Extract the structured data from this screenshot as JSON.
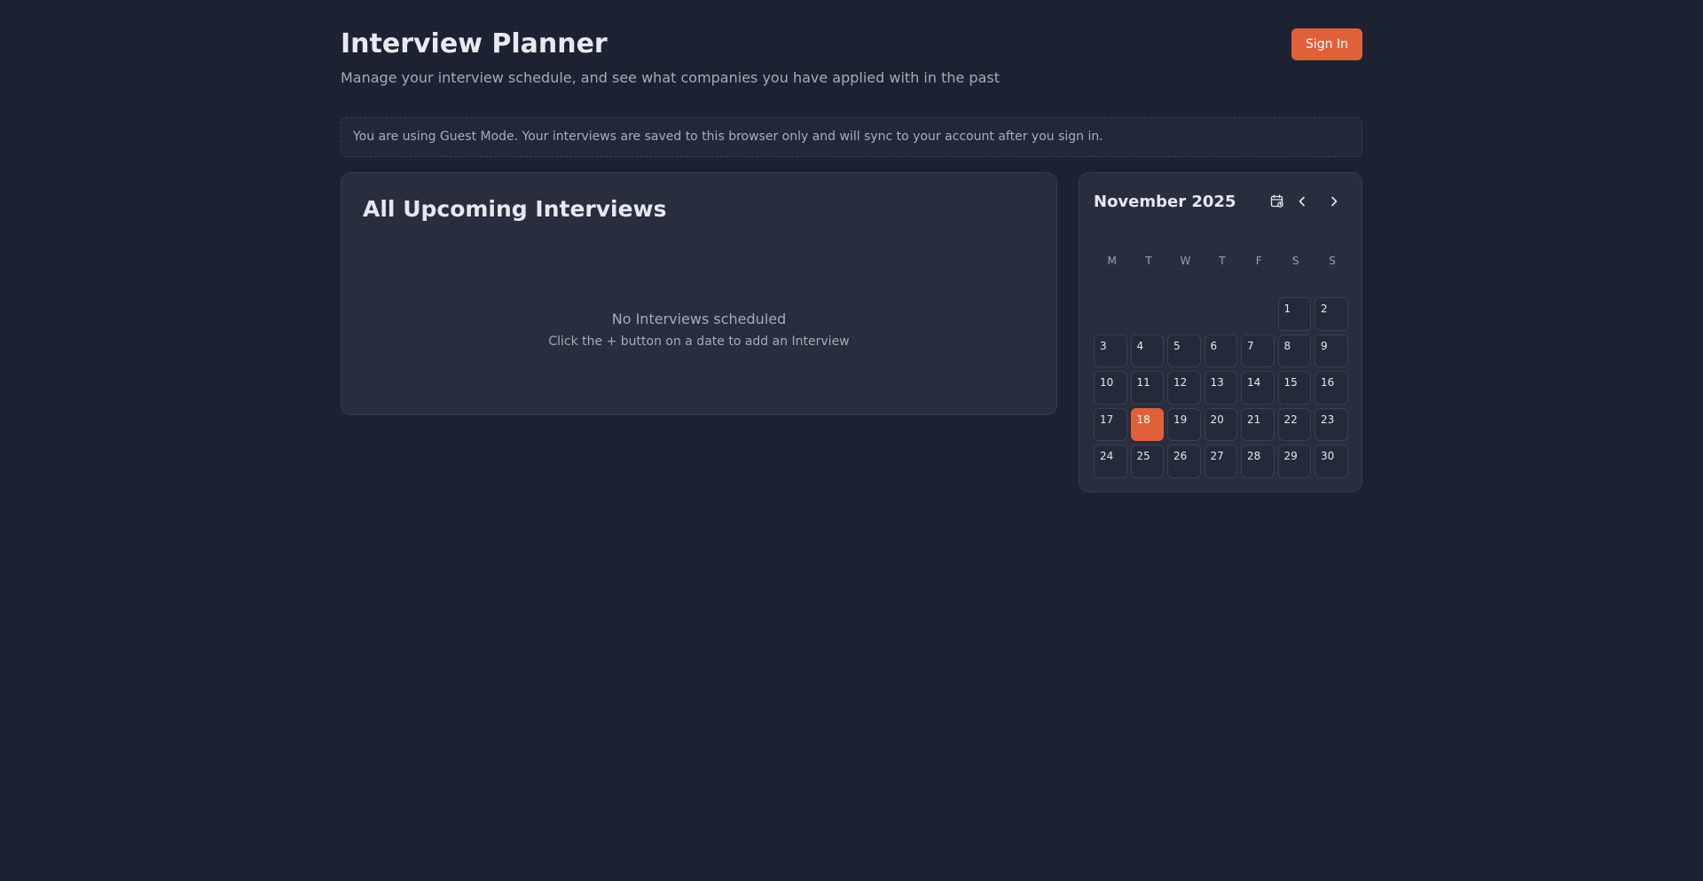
{
  "header": {
    "title": "Interview Planner",
    "subtitle": "Manage your interview schedule, and see what companies you have applied with in the past",
    "sign_in_label": "Sign In"
  },
  "banner": {
    "text": "You are using Guest Mode. Your interviews are saved to this browser only and will sync to your account after you sign in."
  },
  "upcoming": {
    "title": "All Upcoming Interviews",
    "empty_title": "No Interviews scheduled",
    "empty_subtitle": "Click the + button on a date to add an Interview"
  },
  "calendar": {
    "month_label": "November 2025",
    "weekdays": [
      "M",
      "T",
      "W",
      "T",
      "F",
      "S",
      "S"
    ],
    "leading_blanks": 5,
    "days": [
      "1",
      "2",
      "3",
      "4",
      "5",
      "6",
      "7",
      "8",
      "9",
      "10",
      "11",
      "12",
      "13",
      "14",
      "15",
      "16",
      "17",
      "18",
      "19",
      "20",
      "21",
      "22",
      "23",
      "24",
      "25",
      "26",
      "27",
      "28",
      "29",
      "30"
    ],
    "today": "18",
    "icons": {
      "today": "calendar-today-icon",
      "prev": "chevron-left-icon",
      "next": "chevron-right-icon"
    }
  },
  "colors": {
    "background": "#1d2232",
    "card": "#282e3e",
    "accent": "#e0603a"
  }
}
